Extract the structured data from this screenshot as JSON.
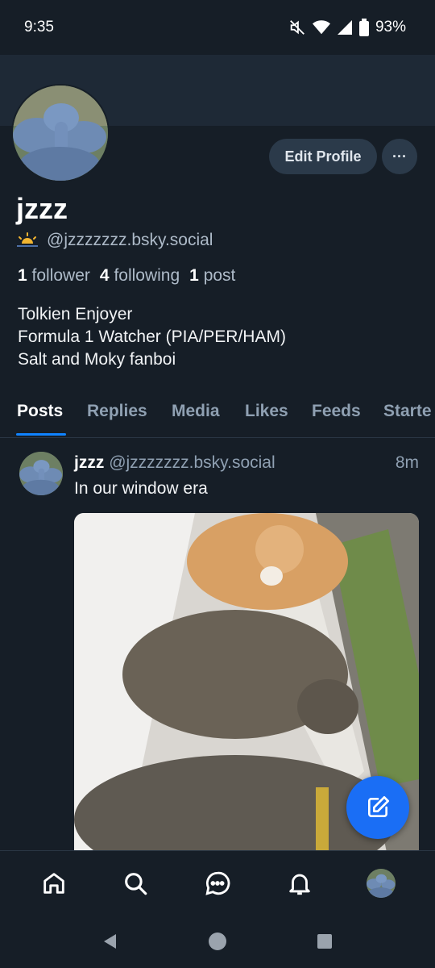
{
  "status_bar": {
    "time": "9:35",
    "battery": "93%"
  },
  "profile": {
    "display_name": "jzzz",
    "handle": "@jzzzzzzz.bsky.social",
    "followers_count": "1",
    "followers_label": "follower",
    "following_count": "4",
    "following_label": "following",
    "posts_count": "1",
    "posts_label": "post",
    "bio_lines": [
      "Tolkien Enjoyer",
      "Formula 1 Watcher (PIA/PER/HAM)",
      "Salt and Moky fanboi"
    ],
    "edit_button": "Edit Profile",
    "more_button": "···"
  },
  "tabs": [
    "Posts",
    "Replies",
    "Media",
    "Likes",
    "Feeds",
    "Starte"
  ],
  "post": {
    "author": "jzzz",
    "handle": "@jzzzzzzz.bsky.social",
    "time": "8m",
    "text": "In our window era"
  },
  "colors": {
    "background": "#161e27",
    "accent": "#1083fe",
    "fab": "#1a6ef5"
  },
  "icons": {
    "nav": [
      "home-icon",
      "search-icon",
      "chat-icon",
      "bell-icon",
      "avatar"
    ],
    "android": [
      "back-icon",
      "home-circle-icon",
      "recents-icon"
    ]
  }
}
